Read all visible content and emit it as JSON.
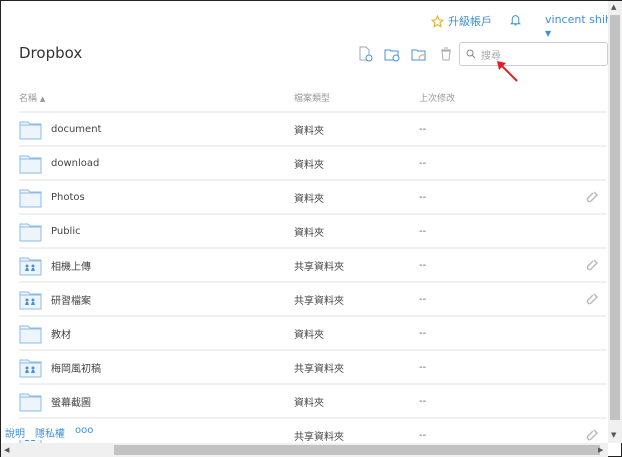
{
  "header": {
    "upgrade": "升級帳戶",
    "user": "vincent shih"
  },
  "title": "Dropbox",
  "search": {
    "placeholder": "搜尋"
  },
  "columns": {
    "name": "名稱",
    "type": "檔案類型",
    "modified": "上次修改"
  },
  "rows": [
    {
      "name": "document",
      "type": "資料夾",
      "modified": "--",
      "shared": false,
      "link": false
    },
    {
      "name": "download",
      "type": "資料夾",
      "modified": "--",
      "shared": false,
      "link": false
    },
    {
      "name": "Photos",
      "type": "資料夾",
      "modified": "--",
      "shared": false,
      "link": true
    },
    {
      "name": "Public",
      "type": "資料夾",
      "modified": "--",
      "shared": false,
      "link": false
    },
    {
      "name": "相機上傳",
      "type": "共享資料夾",
      "modified": "--",
      "shared": true,
      "link": true
    },
    {
      "name": "研習檔案",
      "type": "共享資料夾",
      "modified": "--",
      "shared": true,
      "link": true
    },
    {
      "name": "教材",
      "type": "資料夾",
      "modified": "--",
      "shared": false,
      "link": false
    },
    {
      "name": "梅岡風初稿",
      "type": "共享資料夾",
      "modified": "--",
      "shared": true,
      "link": false
    },
    {
      "name": "螢幕截圖",
      "type": "資料夾",
      "modified": "--",
      "shared": false,
      "link": false
    },
    {
      "name": "",
      "type": "共享資料夾",
      "modified": "--",
      "shared": true,
      "link": true
    }
  ],
  "footer": {
    "help": "說明",
    "privacy": "隱私權",
    "more": "ooo"
  }
}
